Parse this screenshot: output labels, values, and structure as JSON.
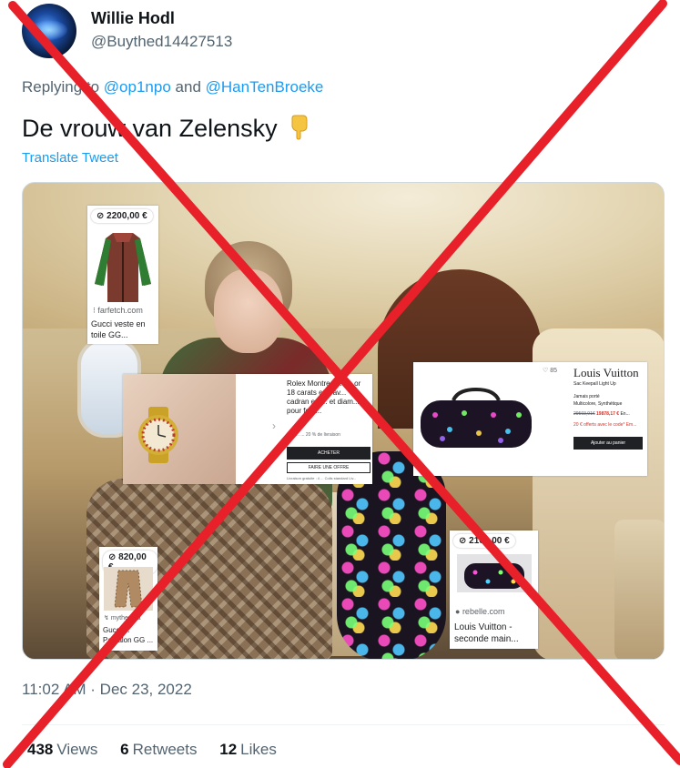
{
  "author": {
    "display_name": "Willie Hodl",
    "handle": "@Buythed14427513"
  },
  "reply": {
    "prefix": "Replying to",
    "mention_1": "@op1npo",
    "joiner": "and",
    "mention_2": "@HanTenBroeke"
  },
  "tweet": {
    "text": "De vrouw van Zelensky",
    "translate_label": "Translate Tweet"
  },
  "media": {
    "gucci_jacket": {
      "price": "2200,00 €",
      "source": "farfetch.com",
      "caption": "Gucci veste en toile GG..."
    },
    "rolex": {
      "title": "Rolex Montre P... en or 18 carats et... av... cadran en ... et diam... pour fem...",
      "small_text": "10 0... ... 20 % de livraison",
      "buy_label": "ACHETER",
      "offer_label": "FAIRE UNE OFFRE",
      "shipping_text": "Livraison gratuite : 4 ... Colis standard Liv..."
    },
    "lv_sac": {
      "likes": "85",
      "brand": "Louis Vuitton",
      "product": "Sac Keepall Light Up",
      "condition": "Jamais porté",
      "material": "Multicolore, Synthétique",
      "old_price": "29593,91€",
      "new_price": "19878,17 €",
      "price_extra": "En...",
      "promo": "20 € offerts avec le code* Em...",
      "cart_label": "Ajouter au panier"
    },
    "gucci_pants": {
      "price": "820,00 €",
      "source": "mytheresa",
      "caption": "Gucci ... Pantalon GG ..."
    },
    "lv_rebelle": {
      "price": "2100,00 €",
      "source": "rebelle.com",
      "caption": "Louis Vuitton - seconde main..."
    }
  },
  "meta": {
    "timestamp": "11:02 AM · Dec 23, 2022"
  },
  "stats": {
    "views_count": "438",
    "views_label": "Views",
    "retweets_count": "6",
    "retweets_label": "Retweets",
    "likes_count": "12",
    "likes_label": "Likes"
  },
  "colors": {
    "link_blue": "#1d9bf0",
    "secondary_text": "#536471",
    "cross_red": "#e8202a"
  },
  "icons": [
    "more-icon",
    "pointing-down-emoji",
    "tag-icon",
    "heart-icon"
  ]
}
